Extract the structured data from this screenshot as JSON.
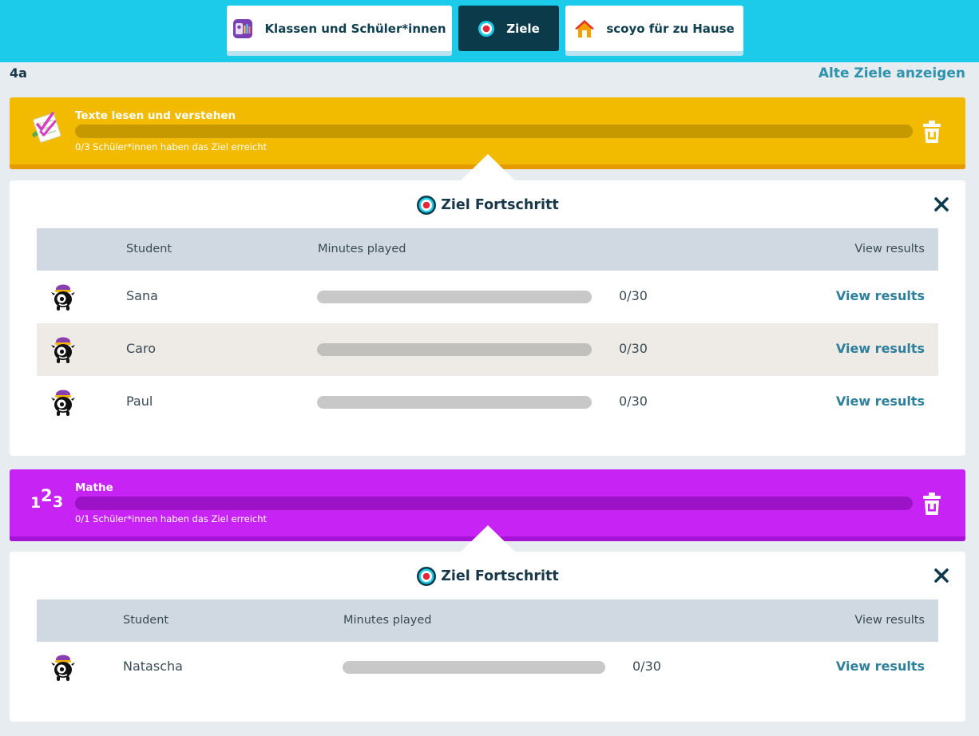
{
  "nav": {
    "tabs": [
      {
        "label": "Klassen und Schüler*innen",
        "icon": "class-students-icon",
        "active": false
      },
      {
        "label": "Ziele",
        "icon": "target-icon",
        "active": true
      },
      {
        "label": "scoyo für zu Hause",
        "icon": "home-icon",
        "active": false
      }
    ]
  },
  "class_name": "4a",
  "old_goals_link": "Alte Ziele anzeigen",
  "colors": {
    "nav_bg": "#1bcbe9",
    "active_tab": "#0b3b4b",
    "goal_reading": "#f2bb00",
    "goal_math": "#c623f4",
    "link": "#2e7f9c"
  },
  "goals": [
    {
      "title": "Texte lesen und verstehen",
      "icon": "reading-checklist-icon",
      "progress": 0,
      "status": "0/3 Schüler*innen haben das Ziel erreicht",
      "panel": {
        "title": "Ziel Fortschritt",
        "columns": {
          "student": "Student",
          "minutes": "Minutes played",
          "results": "View results"
        },
        "rows": [
          {
            "name": "Sana",
            "progress": 0,
            "value": "0/30",
            "link": "View results"
          },
          {
            "name": "Caro",
            "progress": 0,
            "value": "0/30",
            "link": "View results"
          },
          {
            "name": "Paul",
            "progress": 0,
            "value": "0/30",
            "link": "View results"
          }
        ]
      }
    },
    {
      "title": "Mathe",
      "icon": "numbers-123-icon",
      "progress": 0,
      "status": "0/1 Schüler*innen haben das Ziel erreicht",
      "panel": {
        "title": "Ziel Fortschritt",
        "columns": {
          "student": "Student",
          "minutes": "Minutes played",
          "results": "View results"
        },
        "rows": [
          {
            "name": "Natascha",
            "progress": 0,
            "value": "0/30",
            "link": "View results"
          }
        ]
      }
    }
  ]
}
